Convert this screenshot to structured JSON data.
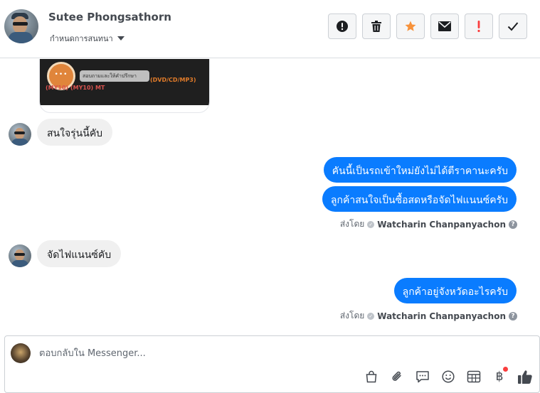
{
  "header": {
    "contact_name": "Sutee Phongsathorn",
    "assign_label": "กำหนดการสนทนา",
    "actions": [
      {
        "name": "report-spam-button",
        "icon": "alert-circle-icon"
      },
      {
        "name": "delete-button",
        "icon": "trash-icon"
      },
      {
        "name": "star-button",
        "icon": "star-icon",
        "color": "#f7923b"
      },
      {
        "name": "mark-unread-button",
        "icon": "envelope-icon"
      },
      {
        "name": "follow-up-button",
        "icon": "exclamation-icon",
        "color": "#fa3e3e"
      },
      {
        "name": "mark-done-button",
        "icon": "check-icon"
      }
    ]
  },
  "card": {
    "pill_text": "สอบถามและให้คำปรึกษา",
    "left_text": "(MY10) (MY10) MT",
    "right_text": "(DVD/CD/MP3)"
  },
  "messages": [
    {
      "direction": "in",
      "text": "สนใจรุ่นนี้คับ"
    },
    {
      "direction": "out",
      "text": "คันนี้เป็นรถเข้าใหม่ยังไม่ได้ตีราคานะครับ"
    },
    {
      "direction": "out",
      "text": "ลูกค้าสนใจเป็นซื้อสดหรือจัดไฟแนนซ์ครับ"
    },
    {
      "direction": "in",
      "text": "จัดไฟแนนซ์คับ"
    },
    {
      "direction": "out",
      "text": "ลูกค้าอยู่จังหวัดอะไรครับ"
    }
  ],
  "sent_by": {
    "prefix": "ส่งโดย",
    "agent": "Watcharin Chanpanyachon",
    "help": "?"
  },
  "composer": {
    "placeholder": "ตอบกลับใน Messenger...",
    "value": "",
    "tools": [
      "shopping-bag-icon",
      "paperclip-icon",
      "saved-reply-icon",
      "emoji-icon",
      "appointment-icon",
      "baht-icon",
      "thumbs-up-icon"
    ],
    "baht_symbol": "฿"
  }
}
